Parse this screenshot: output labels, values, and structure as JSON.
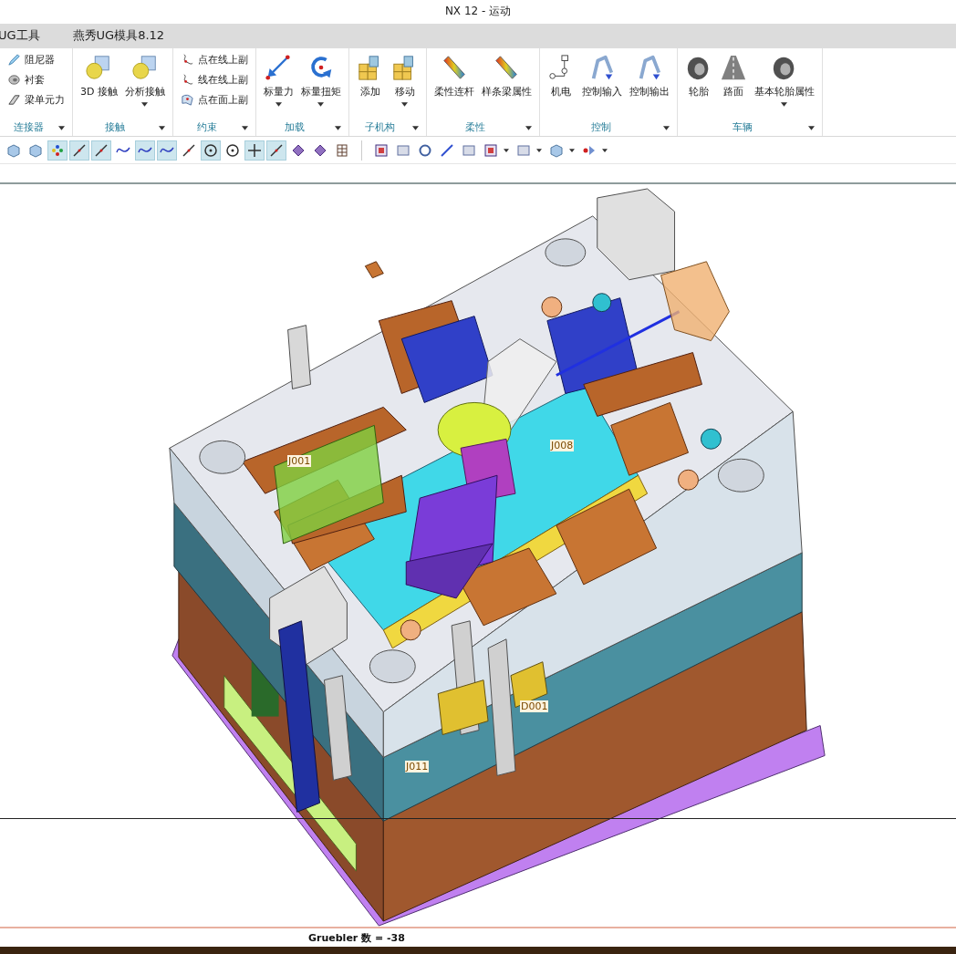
{
  "window": {
    "title": "NX 12 - 运动"
  },
  "menu_tabs": [
    {
      "label": "UG工具"
    },
    {
      "label": "燕秀UG模具8.12"
    }
  ],
  "ribbon_groups": [
    {
      "label": "连接器",
      "items": [
        {
          "label": "阻尼器",
          "kind": "small"
        },
        {
          "label": "衬套",
          "kind": "small"
        },
        {
          "label": "梁单元力",
          "kind": "small"
        }
      ]
    },
    {
      "label": "接触",
      "items": [
        {
          "label": "3D 接触",
          "kind": "large",
          "dropdown": false
        },
        {
          "label": "分析接触",
          "kind": "large",
          "dropdown": true
        }
      ]
    },
    {
      "label": "约束",
      "items": [
        {
          "label": "点在线上副",
          "kind": "small"
        },
        {
          "label": "线在线上副",
          "kind": "small"
        },
        {
          "label": "点在面上副",
          "kind": "small"
        }
      ]
    },
    {
      "label": "加载",
      "items": [
        {
          "label": "标量力",
          "kind": "large",
          "dropdown": true
        },
        {
          "label": "标量扭矩",
          "kind": "large",
          "dropdown": true
        }
      ]
    },
    {
      "label": "子机构",
      "items": [
        {
          "label": "添加",
          "kind": "large",
          "dropdown": false
        },
        {
          "label": "移动",
          "kind": "large",
          "dropdown": true
        }
      ]
    },
    {
      "label": "柔性",
      "items": [
        {
          "label": "柔性连杆",
          "kind": "large",
          "dropdown": false
        },
        {
          "label": "样条梁属性",
          "kind": "large",
          "dropdown": false
        }
      ]
    },
    {
      "label": "控制",
      "items": [
        {
          "label": "机电",
          "kind": "large",
          "dropdown": false
        },
        {
          "label": "控制输入",
          "kind": "large",
          "dropdown": false
        },
        {
          "label": "控制输出",
          "kind": "large",
          "dropdown": false
        }
      ]
    },
    {
      "label": "车辆",
      "items": [
        {
          "label": "轮胎",
          "kind": "large",
          "dropdown": false
        },
        {
          "label": "路面",
          "kind": "large",
          "dropdown": false
        },
        {
          "label": "基本轮胎属性",
          "kind": "large",
          "dropdown": true
        }
      ]
    }
  ],
  "toolbar": {
    "left": [
      {
        "selected": false
      },
      {
        "selected": false
      },
      {
        "selected": true
      },
      {
        "selected": true
      },
      {
        "selected": true
      },
      {
        "selected": false
      },
      {
        "selected": true
      },
      {
        "selected": true
      },
      {
        "selected": false
      },
      {
        "selected": true
      },
      {
        "selected": false
      },
      {
        "selected": true
      },
      {
        "selected": true
      },
      {
        "selected": false
      },
      {
        "selected": false
      },
      {
        "selected": false
      }
    ],
    "right": [
      {
        "dropdown": false
      },
      {
        "dropdown": false
      },
      {
        "dropdown": false
      },
      {
        "dropdown": false
      },
      {
        "dropdown": false
      },
      {
        "dropdown": true
      },
      {
        "dropdown": true
      },
      {
        "dropdown": true
      },
      {
        "dropdown": true
      }
    ]
  },
  "viewport": {
    "labels": [
      {
        "text": "J001"
      },
      {
        "text": "J008"
      },
      {
        "text": "D001"
      },
      {
        "text": "J011"
      }
    ]
  },
  "status_bar": {
    "text": "Gruebler 数 = -38"
  }
}
